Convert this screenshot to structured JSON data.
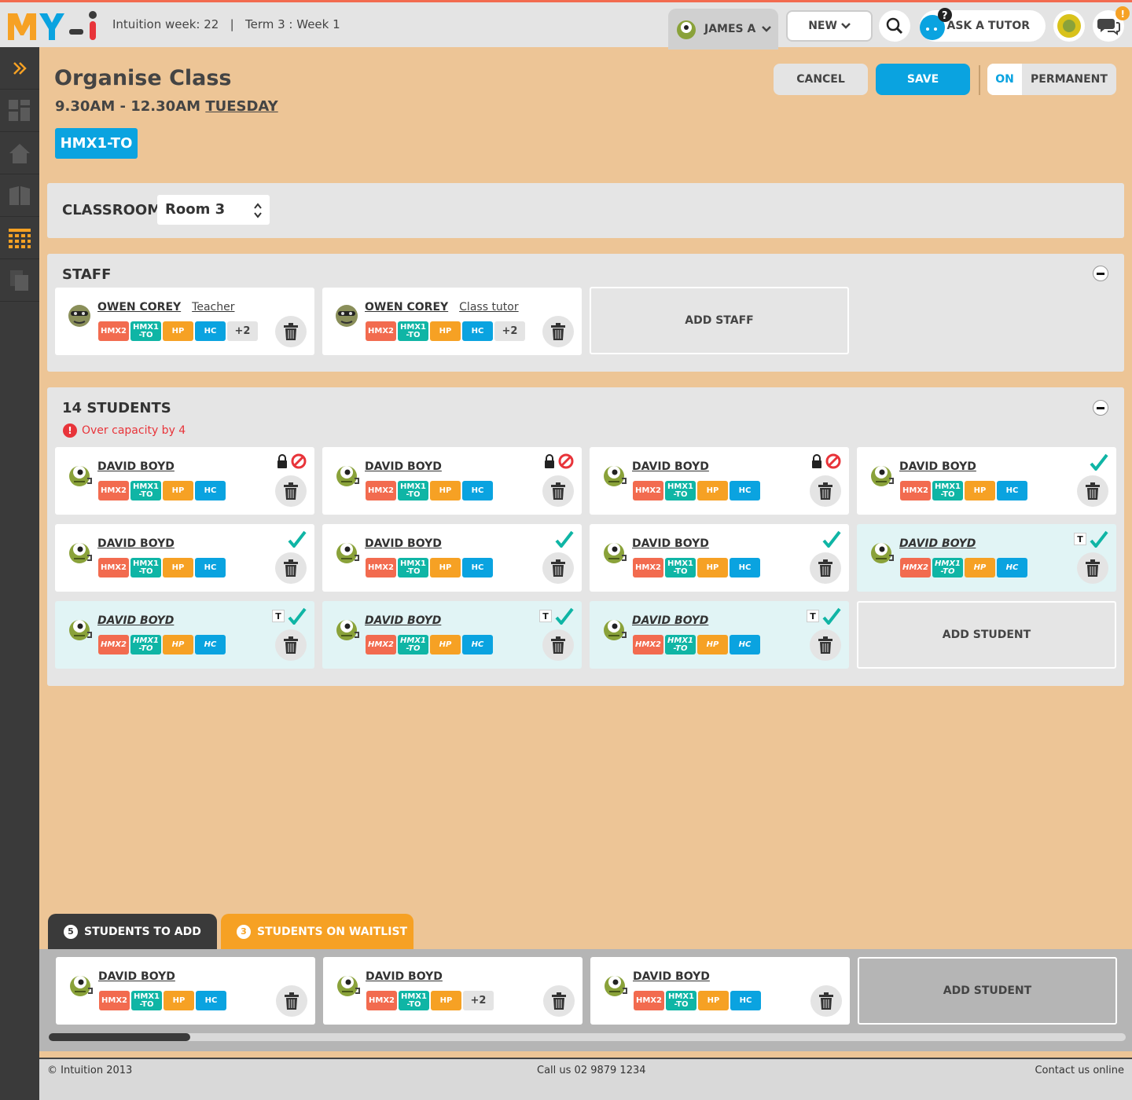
{
  "header": {
    "logo": "MY-I",
    "week_info": "Intuition week: 22",
    "term_info": "Term 3 : Week 1",
    "user_name": "JAMES A",
    "new_label": "NEW",
    "ask_label": "ASK A TUTOR"
  },
  "page": {
    "title": "Organise Class",
    "time": "9.30AM - 12.30AM",
    "day": "TUESDAY",
    "class_tag": "HMX1-TO"
  },
  "actions": {
    "cancel": "CANCEL",
    "save": "SAVE",
    "on": "ON",
    "permanent": "PERMANENT"
  },
  "classroom": {
    "label": "CLASSROOM",
    "value": "Room 3"
  },
  "staff": {
    "title": "STAFF",
    "add_label": "ADD STAFF",
    "members": [
      {
        "name": "OWEN COREY",
        "role": "Teacher",
        "more": "+2"
      },
      {
        "name": "OWEN COREY",
        "role": "Class tutor",
        "more": "+2"
      }
    ]
  },
  "tags": {
    "t1": "HMX2",
    "t2": "HMX1 -TO",
    "t3": "HP",
    "t4": "HC"
  },
  "students": {
    "title": "14 STUDENTS",
    "warning": "Over capacity by 4",
    "add_label": "ADD STUDENT",
    "name": "DAVID BOYD",
    "t_label": "T",
    "list": [
      {
        "name": "DAVID BOYD",
        "status": "locked"
      },
      {
        "name": "DAVID BOYD",
        "status": "locked"
      },
      {
        "name": "DAVID BOYD",
        "status": "locked"
      },
      {
        "name": "DAVID BOYD",
        "status": "ok"
      },
      {
        "name": "DAVID BOYD",
        "status": "ok"
      },
      {
        "name": "DAVID BOYD",
        "status": "ok"
      },
      {
        "name": "DAVID BOYD",
        "status": "ok"
      },
      {
        "name": "DAVID BOYD",
        "status": "trial"
      },
      {
        "name": "DAVID BOYD",
        "status": "trial"
      },
      {
        "name": "DAVID BOYD",
        "status": "trial"
      },
      {
        "name": "DAVID BOYD",
        "status": "trial"
      }
    ]
  },
  "bottom": {
    "tab1_count": "5",
    "tab1_label": "STUDENTS TO ADD",
    "tab2_count": "3",
    "tab2_label": "STUDENTS ON WAITLIST",
    "add_label": "ADD STUDENT",
    "more": "+2",
    "list": [
      {
        "name": "DAVID BOYD"
      },
      {
        "name": "DAVID BOYD"
      },
      {
        "name": "DAVID BOYD"
      }
    ]
  },
  "footer": {
    "copyright": "© Intuition 2013",
    "phone": "Call us 02 9879 1234",
    "contact": "Contact us online"
  },
  "colors": {
    "accent": "#0aa3e0",
    "background": "#edc596",
    "teal": "#0fb5a5",
    "orange": "#f6a124",
    "red": "#f26b4f"
  }
}
